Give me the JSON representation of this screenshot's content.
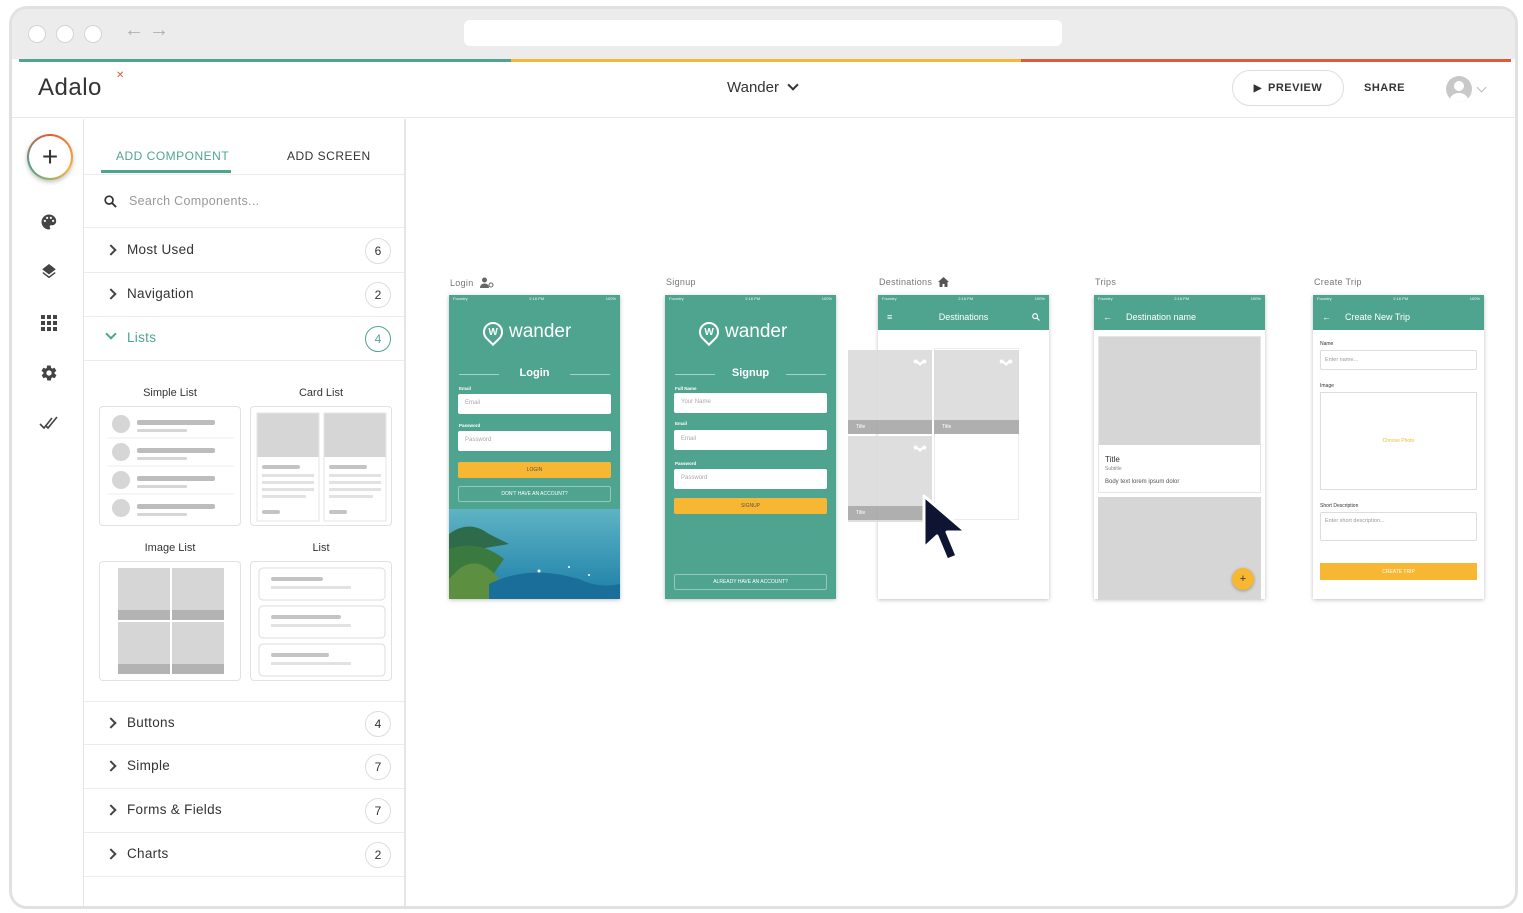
{
  "app": {
    "logo": "Adalo",
    "project_name": "Wander",
    "preview_label": "PREVIEW",
    "share_label": "SHARE"
  },
  "colors": {
    "brand_teal": "#4fa48f",
    "brand_yellow": "#f7b733",
    "brand_red": "#e05b3c"
  },
  "panel": {
    "tabs": [
      {
        "label": "ADD COMPONENT",
        "active": true
      },
      {
        "label": "ADD SCREEN",
        "active": false
      }
    ],
    "search_placeholder": "Search Components...",
    "categories_top": [
      {
        "label": "Most Used",
        "count": "6"
      },
      {
        "label": "Navigation",
        "count": "2"
      },
      {
        "label": "Lists",
        "count": "4",
        "open": true
      }
    ],
    "list_components": [
      {
        "label": "Simple List"
      },
      {
        "label": "Card List"
      },
      {
        "label": "Image List"
      },
      {
        "label": "List"
      }
    ],
    "categories_bottom": [
      {
        "label": "Buttons",
        "count": "4"
      },
      {
        "label": "Simple",
        "count": "7"
      },
      {
        "label": "Forms & Fields",
        "count": "7"
      },
      {
        "label": "Charts",
        "count": "2"
      }
    ]
  },
  "rail_icons": [
    "add-icon",
    "palette-icon",
    "layers-icon",
    "grid-icon",
    "gear-icon",
    "double-check-icon"
  ],
  "screens": {
    "login": {
      "name": "Login",
      "logo_text": "wander",
      "heading": "Login",
      "email_label": "Email",
      "email_placeholder": "Email",
      "password_label": "Password",
      "password_placeholder": "Password",
      "button": "LOGIN",
      "link": "DON'T HAVE AN ACCOUNT?"
    },
    "signup": {
      "name": "Signup",
      "logo_text": "wander",
      "heading": "Signup",
      "fullname_label": "Full Name",
      "fullname_placeholder": "Your Name",
      "email_label": "Email",
      "email_placeholder": "Email",
      "password_label": "Password",
      "password_placeholder": "Password",
      "button": "SIGNUP",
      "link": "ALREADY HAVE AN ACCOUNT?"
    },
    "destinations": {
      "name": "Destinations",
      "title": "Destinations",
      "tile_label": "Title"
    },
    "trips": {
      "name": "Trips",
      "title": "Destination name",
      "card_title": "Title",
      "card_subtitle": "Subtitle",
      "card_body": "Body text lorem ipsum dolor"
    },
    "create_trip": {
      "name": "Create Trip",
      "title": "Create New Trip",
      "name_label": "Name",
      "name_placeholder": "Enter name...",
      "image_label": "Image",
      "choose_photo": "Choose Photo",
      "desc_label": "Short Description",
      "desc_placeholder": "Enter short description...",
      "button": "CREATE TRIP"
    }
  },
  "status_bar": {
    "carrier": "Foundry",
    "time": "2:16 PM",
    "battery": "100%"
  }
}
